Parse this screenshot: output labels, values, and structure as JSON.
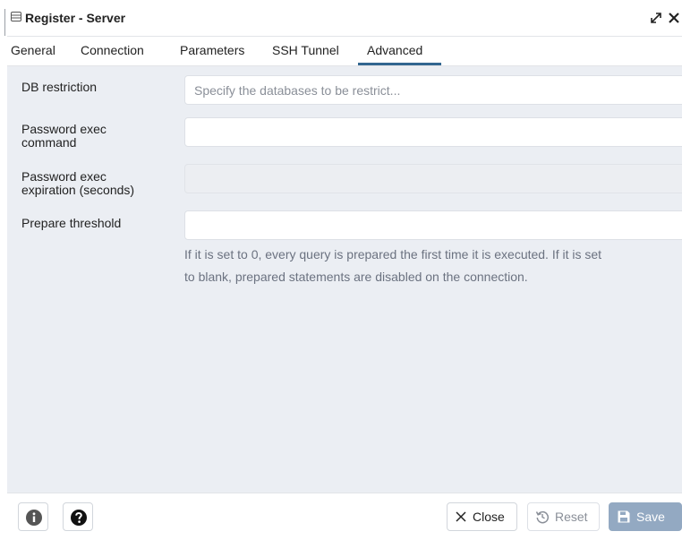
{
  "window": {
    "title": "Register - Server"
  },
  "tabs": [
    {
      "label": "General"
    },
    {
      "label": "Connection"
    },
    {
      "label": "Parameters"
    },
    {
      "label": "SSH Tunnel"
    },
    {
      "label": "Advanced",
      "active": true
    }
  ],
  "form": {
    "db_restriction": {
      "label": "DB restriction",
      "value": "",
      "placeholder": "Specify the databases to be restrict..."
    },
    "password_exec_command": {
      "label_line1": "Password exec",
      "label_line2": "command",
      "value": ""
    },
    "password_exec_expiration": {
      "label_line1": "Password exec",
      "label_line2": "expiration (seconds)",
      "value": "",
      "disabled": true
    },
    "prepare_threshold": {
      "label": "Prepare threshold",
      "value": "",
      "help_line1": "If it is set to 0, every query is prepared the first time it is executed. If it is set",
      "help_line2": "to blank, prepared statements are disabled on the connection."
    }
  },
  "footer": {
    "close_label": "Close",
    "reset_label": "Reset",
    "save_label": "Save"
  },
  "colors": {
    "accent": "#326690",
    "content_bg": "#ebeef3",
    "save_button_disabled": "#93a9c2"
  },
  "icons": {
    "window": "server-window-icon",
    "expand": "expand-icon",
    "close": "close-icon",
    "info": "info-icon",
    "help": "help-icon",
    "close_button": "x-icon",
    "reset": "reset-icon",
    "save": "save-icon"
  }
}
